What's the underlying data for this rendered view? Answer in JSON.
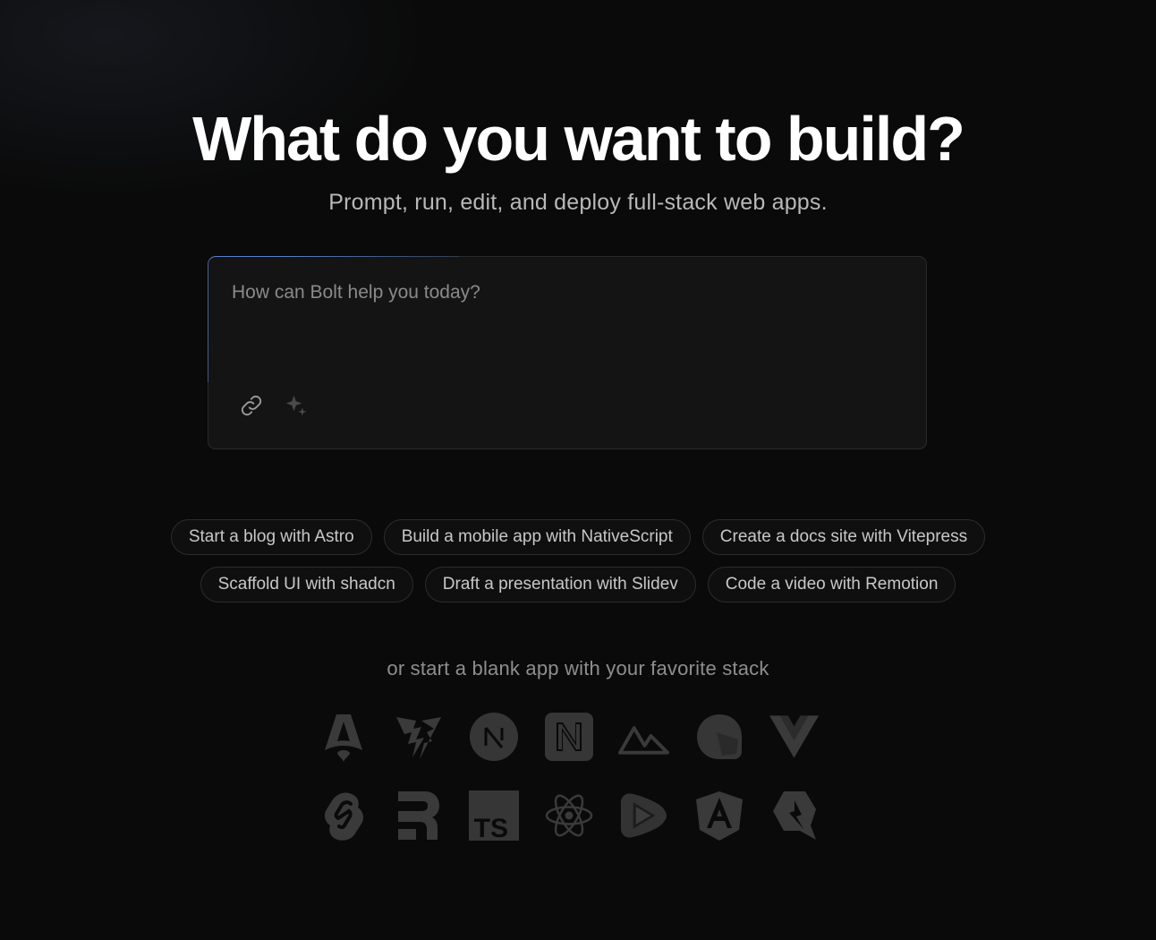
{
  "hero": {
    "title": "What do you want to build?",
    "subtitle": "Prompt, run, edit, and deploy full-stack web apps."
  },
  "prompt": {
    "placeholder": "How can Bolt help you today?",
    "value": "",
    "attach_icon": "link-icon",
    "enhance_icon": "sparkle-icon"
  },
  "examples": {
    "row1": [
      "Start a blog with Astro",
      "Build a mobile app with NativeScript",
      "Create a docs site with Vitepress"
    ],
    "row2": [
      "Scaffold UI with shadcn",
      "Draft a presentation with Slidev",
      "Code a video with Remotion"
    ]
  },
  "stacks": {
    "label": "or start a blank app with your favorite stack",
    "row1": [
      "astro-icon",
      "vite-icon",
      "nextjs-icon",
      "nuxt-icon",
      "vue-nuxt-icon",
      "qwik-icon",
      "vue-icon"
    ],
    "row2": [
      "svelte-icon",
      "remix-icon",
      "typescript-icon",
      "react-icon",
      "slidev-icon",
      "angular-icon",
      "qwik-alt-icon"
    ]
  },
  "colors": {
    "background": "#0a0a0a",
    "icon_fill": "#3a3a3a",
    "accent_border": "#5a8cdc"
  }
}
